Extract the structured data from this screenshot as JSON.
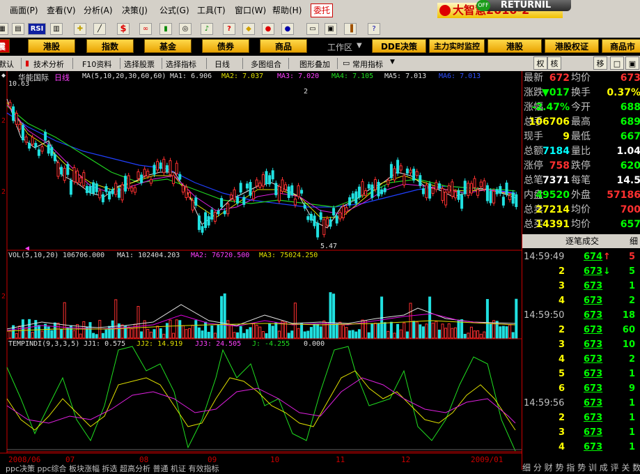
{
  "menu": {
    "items": [
      "画面(P)",
      "查看(V)",
      "分析(A)",
      "决策(J)",
      "公式(G)",
      "工具(T)",
      "窗口(W)",
      "帮助(H)"
    ],
    "weituo": "委托"
  },
  "overlay": {
    "returnil": "RETURNIL",
    "returnil_off": "OFF",
    "brand": "大智慧2010-2"
  },
  "toolbar": {
    "icons": [
      "grid-icon",
      "grid2-icon",
      "rsi-icon",
      "bars-icon",
      "cross-icon",
      "ruler-icon",
      "dollar-icon",
      "glasses-icon",
      "barchart-icon",
      "binoculars-icon",
      "bell-icon",
      "question-icon",
      "diamond-icon",
      "cd-icon",
      "cd2-icon",
      "disk-icon",
      "card-icon",
      "book-icon",
      "help-cursor-icon"
    ],
    "rsi_label": "RSI",
    "dollar_label": "$"
  },
  "nav": {
    "buttons": [
      "港股",
      "指数",
      "基金",
      "债券",
      "商品"
    ],
    "workspace": "工作区",
    "right_buttons": [
      "DDE决策",
      "主力实时监控",
      "港股",
      "港股权证",
      "商品市"
    ]
  },
  "tabbar": {
    "items": [
      "默认",
      "技术分析",
      "F10资料",
      "选择股票",
      "选择指标",
      "日线",
      "多图组合",
      "图形叠加",
      "常用指标"
    ],
    "right_tabs": [
      "权",
      "核",
      "移",
      "",
      ""
    ]
  },
  "main_chart": {
    "stock_name": "华能国际",
    "period": "日线",
    "ma_title": "MA(5,10,20,30,60,60)",
    "ma1": "MA1: 6.906",
    "ma2": "MA2: 7.037",
    "ma3": "MA3: 7.020",
    "ma4": "MA4: 7.105",
    "ma5": "MA5: 7.013",
    "ma6": "MA6: 7.013",
    "high_mark": "10.63",
    "low_mark": "5.47",
    "mark2": "2",
    "y_ticks": [
      "2",
      "2"
    ]
  },
  "vol_chart": {
    "title": "VOL(5,10,20)",
    "vol": "106706.000",
    "ma1": "MA1: 102404.203",
    "ma2": "MA2: 76720.500",
    "ma3": "MA3: 75024.250",
    "y_tick": "2"
  },
  "ind_chart": {
    "title": "TEMPINDI(9,3,3,5)",
    "jj1": "JJ1: 0.575",
    "jj2": "JJ2: 14.919",
    "jj3": "JJ3: 24.505",
    "j": "J: -4.255",
    "last": "0.000"
  },
  "x_axis": {
    "labels": [
      "2008/06",
      "07",
      "08",
      "09",
      "10",
      "11",
      "12",
      "2009/01"
    ]
  },
  "quote": {
    "rows": [
      {
        "l1": "最新",
        "v1": "672",
        "c1": "#ff3030",
        "l2": "均价",
        "v2": "673",
        "c2": "#ff3030"
      },
      {
        "l1": "涨跌",
        "v1": "▼017",
        "c1": "#00ff00",
        "l2": "换手",
        "v2": "0.37%",
        "c2": "#ffff00"
      },
      {
        "l1": "涨幅",
        "v1": "-2.47%",
        "c1": "#00ff00",
        "l2": "今开",
        "v2": "688",
        "c2": "#00ff00"
      },
      {
        "l1": "总手",
        "v1": "106706",
        "c1": "#ffff00",
        "l2": "最高",
        "v2": "689",
        "c2": "#00ff00"
      },
      {
        "l1": "现手",
        "v1": "9",
        "c1": "#ffff00",
        "l2": "最低",
        "v2": "667",
        "c2": "#00ff00"
      },
      {
        "l1": "总额",
        "v1": "7184",
        "c1": "#00ffff",
        "l2": "量比",
        "v2": "1.04",
        "c2": "#ffffff"
      },
      {
        "l1": "涨停",
        "v1": "758",
        "c1": "#ff3030",
        "l2": "跌停",
        "v2": "620",
        "c2": "#00ff00"
      },
      {
        "l1": "总笔",
        "v1": "7371",
        "c1": "#ffffff",
        "l2": "每笔",
        "v2": "14.5",
        "c2": "#ffffff"
      },
      {
        "l1": "内盘",
        "v1": "49520",
        "c1": "#00ff00",
        "l2": "外盘",
        "v2": "57186",
        "c2": "#ff3030"
      },
      {
        "l1": "总卖",
        "v1": "27214",
        "c1": "#ffff00",
        "l2": "均价",
        "v2": "700",
        "c2": "#ff3030"
      },
      {
        "l1": "总买",
        "v1": "14391",
        "c1": "#ffff00",
        "l2": "均价",
        "v2": "657",
        "c2": "#00ff00"
      }
    ],
    "trade_header": "逐笔成交",
    "trade_tab": "细",
    "trades": [
      {
        "t": "14:59:49",
        "p": "674",
        "arrow": "↑",
        "ac": "#ff3030",
        "v": "5",
        "vc": "#ff3030"
      },
      {
        "t": "",
        "p": "673",
        "arrow": "↓",
        "ac": "#00ff00",
        "v": "5",
        "vc": "#00ff00"
      },
      {
        "t": "",
        "p": "673",
        "arrow": "",
        "ac": "",
        "v": "1",
        "vc": "#00ff00"
      },
      {
        "t": "",
        "p": "673",
        "arrow": "",
        "ac": "",
        "v": "2",
        "vc": "#00ff00"
      },
      {
        "t": "14:59:50",
        "p": "673",
        "arrow": "",
        "ac": "",
        "v": "18",
        "vc": "#00ff00"
      },
      {
        "t": "",
        "p": "673",
        "arrow": "",
        "ac": "",
        "v": "60",
        "vc": "#00ff00"
      },
      {
        "t": "",
        "p": "673",
        "arrow": "",
        "ac": "",
        "v": "10",
        "vc": "#00ff00"
      },
      {
        "t": "",
        "p": "673",
        "arrow": "",
        "ac": "",
        "v": "2",
        "vc": "#00ff00"
      },
      {
        "t": "",
        "p": "673",
        "arrow": "",
        "ac": "",
        "v": "1",
        "vc": "#00ff00"
      },
      {
        "t": "",
        "p": "673",
        "arrow": "",
        "ac": "",
        "v": "9",
        "vc": "#00ff00"
      },
      {
        "t": "14:59:56",
        "p": "673",
        "arrow": "",
        "ac": "",
        "v": "1",
        "vc": "#00ff00"
      },
      {
        "t": "",
        "p": "673",
        "arrow": "",
        "ac": "",
        "v": "1",
        "vc": "#00ff00"
      },
      {
        "t": "",
        "p": "673",
        "arrow": "",
        "ac": "",
        "v": "1",
        "vc": "#00ff00"
      },
      {
        "t": "",
        "p": "673",
        "arrow": "",
        "ac": "",
        "v": "1",
        "vc": "#00ff00"
      }
    ],
    "trade_counts": [
      "",
      "2",
      "3",
      "4",
      "",
      "2",
      "3",
      "4",
      "5",
      "6",
      "",
      "2",
      "3",
      "4"
    ],
    "bottom_tabs": "细 分 财 势 指 势 训 成 评 关 数"
  },
  "bottom_bar": "ppc决策  ppc综合  板块涨幅  拆选  超高分析  普通  机证  有效指标"
}
